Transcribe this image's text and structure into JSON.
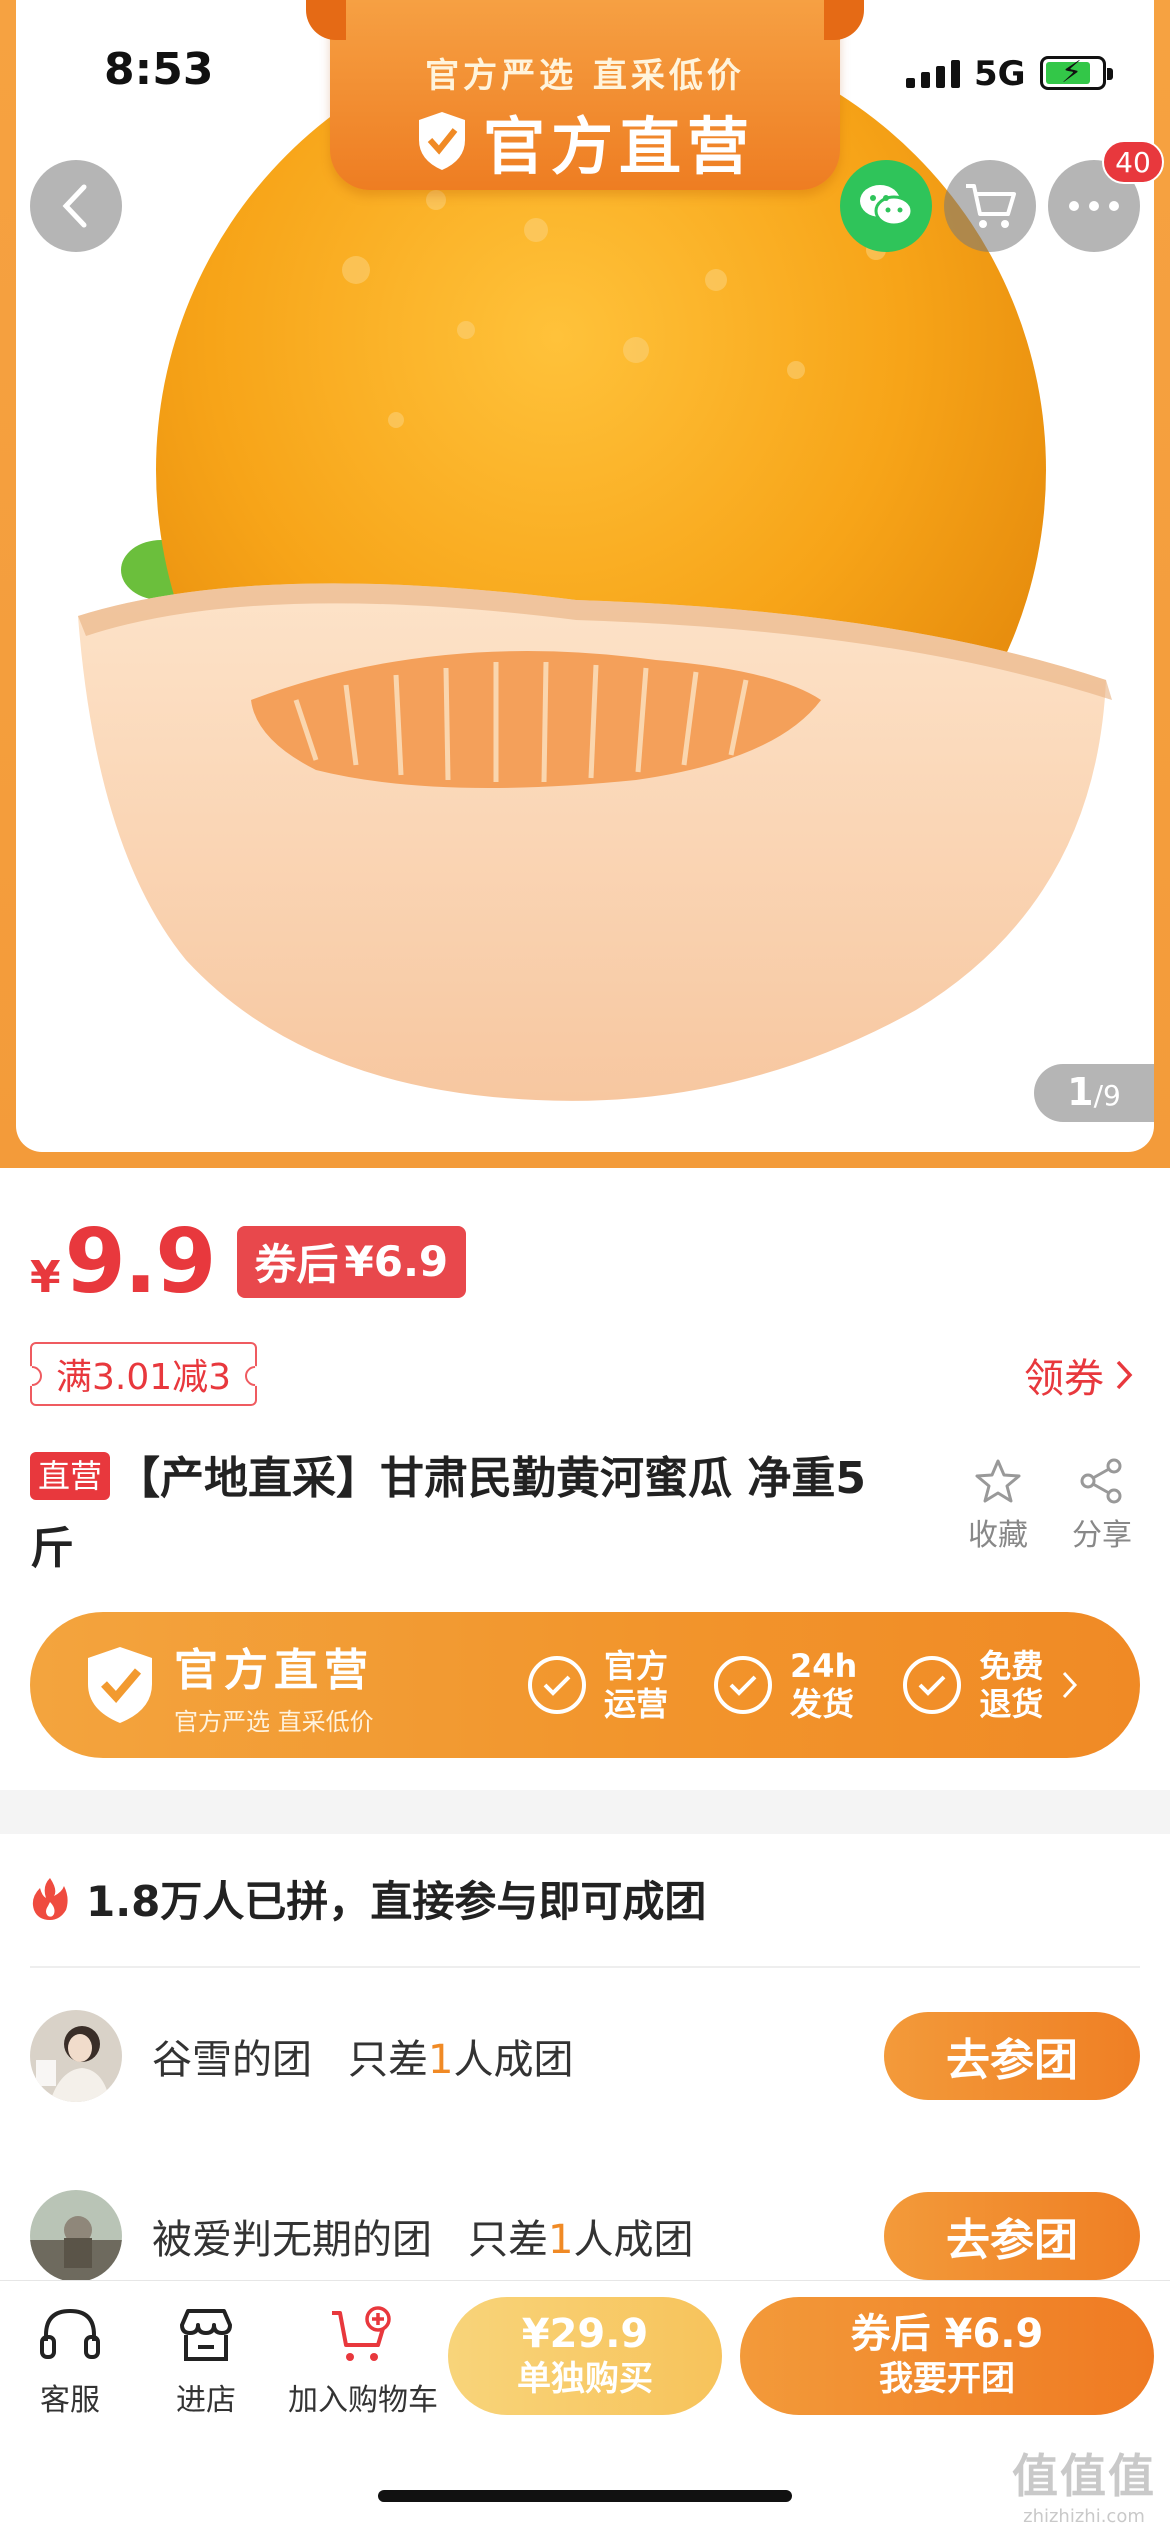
{
  "status_bar": {
    "time": "8:53",
    "network": "5G"
  },
  "banner": {
    "subtitle": "官方严选  直采低价",
    "title": "官方直营"
  },
  "top_actions": {
    "back_icon": "back-icon",
    "cart_badge": "40"
  },
  "image_counter": {
    "current": "1",
    "total": "/9"
  },
  "price": {
    "yen": "¥",
    "value": "9.9",
    "coupon_label": "券后",
    "coupon_value": "¥6.9"
  },
  "discount": {
    "text": "满3.01减3",
    "get_coupon": "领券"
  },
  "product": {
    "tag": "直营",
    "title": "【产地直采】甘肃民勤黄河蜜瓜 净重5斤",
    "fav_label": "收藏",
    "share_label": "分享"
  },
  "official_bar": {
    "title": "官方直营",
    "subtitle": "官方严选 直采低价",
    "items": [
      {
        "line1": "官方",
        "line2": "运营"
      },
      {
        "line1": "24h",
        "line2": "发货"
      },
      {
        "line1": "免费",
        "line2": "退货"
      }
    ]
  },
  "group": {
    "headline": "1.8万人已拼，直接参与即可成团",
    "rows": [
      {
        "name": "谷雪的团",
        "need_prefix": "只差",
        "need_count": "1",
        "need_suffix": "人成团",
        "button": "去参团"
      },
      {
        "name": "被爱判无期的团",
        "need_prefix": "只差",
        "need_count": "1",
        "need_suffix": "人成团",
        "button": "去参团"
      }
    ]
  },
  "bottom_bar": {
    "service_label": "客服",
    "store_label": "进店",
    "cart_label": "加入购物车",
    "single_price": "¥29.9",
    "single_label": "单独购买",
    "group_price": "券后 ¥6.9",
    "group_label": "我要开团"
  },
  "watermark": {
    "big": "值值值",
    "small": "zhizhizhi.com"
  },
  "colors": {
    "accent_orange": "#f08a25",
    "price_red": "#e8383d",
    "wechat_green": "#2fc45a"
  }
}
